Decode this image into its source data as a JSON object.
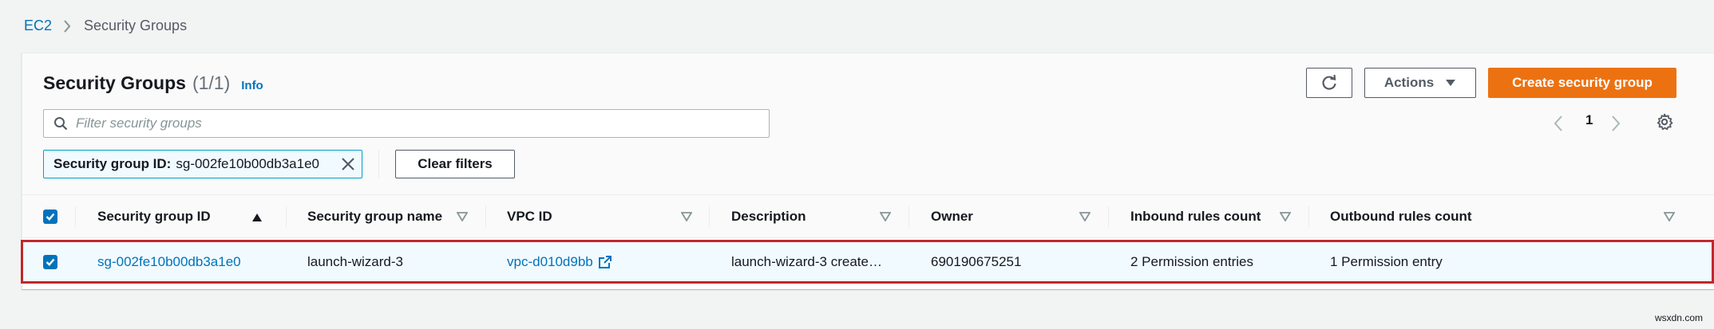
{
  "breadcrumb": {
    "root": "EC2",
    "current": "Security Groups"
  },
  "header": {
    "title": "Security Groups",
    "count": "(1/1)",
    "info": "Info",
    "actions_label": "Actions",
    "create_label": "Create security group"
  },
  "search": {
    "placeholder": "Filter security groups",
    "value": ""
  },
  "pagination": {
    "page": "1"
  },
  "filter_token": {
    "key": "Security group ID:",
    "value": "sg-002fe10b00db3a1e0"
  },
  "clear_filters_label": "Clear filters",
  "table": {
    "columns": [
      "Security group ID",
      "Security group name",
      "VPC ID",
      "Description",
      "Owner",
      "Inbound rules count",
      "Outbound rules count"
    ],
    "rows": [
      {
        "selected": true,
        "sg_id": "sg-002fe10b00db3a1e0",
        "name": "launch-wizard-3",
        "vpc_id": "vpc-d010d9bb",
        "description": "launch-wizard-3 create…",
        "owner": "690190675251",
        "inbound": "2 Permission entries",
        "outbound": "1 Permission entry"
      }
    ]
  },
  "watermark": "wsxdn.com",
  "colors": {
    "link": "#0073bb",
    "primary": "#ec7211",
    "selected_row": "#f1faff",
    "highlight_outline": "#c0282d"
  },
  "icons": [
    "chevron-right-icon",
    "refresh-icon",
    "caret-down-icon",
    "search-icon",
    "chevron-left-icon",
    "gear-icon",
    "close-icon",
    "checkbox-checked-icon",
    "sort-ascending-icon",
    "sort-icon",
    "external-link-icon"
  ]
}
